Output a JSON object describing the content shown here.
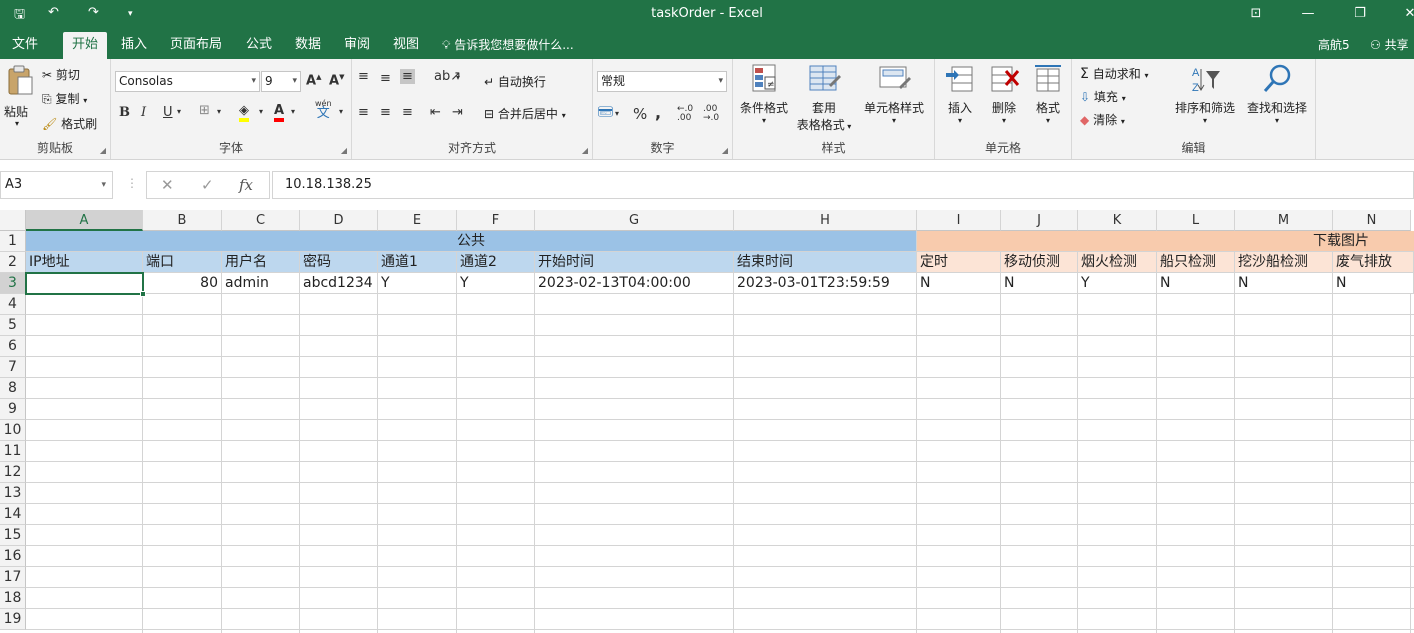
{
  "window": {
    "title": "taskOrder - Excel"
  },
  "quick_access": {
    "save": "🖫",
    "undo": "↶",
    "redo": "↷",
    "more": "▾"
  },
  "tabs": [
    "文件",
    "开始",
    "插入",
    "页面布局",
    "公式",
    "数据",
    "审阅",
    "视图"
  ],
  "tell_me": "告诉我您想要做什么...",
  "user": {
    "name": "高航5",
    "share": "共享"
  },
  "ribbon": {
    "clipboard": {
      "paste": "粘贴",
      "cut": "剪切",
      "copy": "复制",
      "format_painter": "格式刷",
      "label": "剪贴板"
    },
    "font": {
      "name": "Consolas",
      "size": "9",
      "bold": "B",
      "italic": "I",
      "underline": "U",
      "phonetic": "wén",
      "phonetic2": "文",
      "label": "字体"
    },
    "alignment": {
      "wrap": "自动换行",
      "merge": "合并后居中",
      "label": "对齐方式"
    },
    "number": {
      "format": "常规",
      "percent": "%",
      "comma": ",",
      "label": "数字"
    },
    "styles": {
      "conditional": "条件格式",
      "table_format_1": "套用",
      "table_format_2": "表格格式",
      "cell_styles": "单元格样式",
      "label": "样式"
    },
    "cells": {
      "insert": "插入",
      "delete": "删除",
      "format": "格式",
      "label": "单元格"
    },
    "editing": {
      "autosum": "自动求和",
      "fill": "填充",
      "clear": "清除",
      "sort": "排序和筛选",
      "find": "查找和选择",
      "label": "编辑"
    }
  },
  "formula_bar": {
    "name_box": "A3",
    "fx": "fx",
    "value": "10.18.138.25"
  },
  "columns": [
    "A",
    "B",
    "C",
    "D",
    "E",
    "F",
    "G",
    "H",
    "I",
    "J",
    "K",
    "L",
    "M",
    "N"
  ],
  "rows": [
    "1",
    "2",
    "3",
    "4",
    "5",
    "6",
    "7",
    "8",
    "9",
    "10",
    "11",
    "12",
    "13",
    "14",
    "15",
    "16",
    "17",
    "18",
    "19"
  ],
  "sheet": {
    "group_public": "公共",
    "group_download": "下载图片",
    "headers": [
      "IP地址",
      "端口",
      "用户名",
      "密码",
      "通道1",
      "通道2",
      "开始时间",
      "结束时间",
      "定时",
      "移动侦测",
      "烟火检测",
      "船只检测",
      "挖沙船检测",
      "废气排放"
    ],
    "row3": [
      "",
      "80",
      "admin",
      "abcd1234",
      "Y",
      "Y",
      "2023-02-13T04:00:00",
      "2023-03-01T23:59:59",
      "N",
      "N",
      "Y",
      "N",
      "N",
      "N"
    ]
  },
  "colors": {
    "excel_green": "#217346",
    "public_header": "#9bc2e6",
    "public_sub": "#bdd7ee",
    "download_header": "#f8cbad",
    "download_sub": "#fce4d6"
  }
}
